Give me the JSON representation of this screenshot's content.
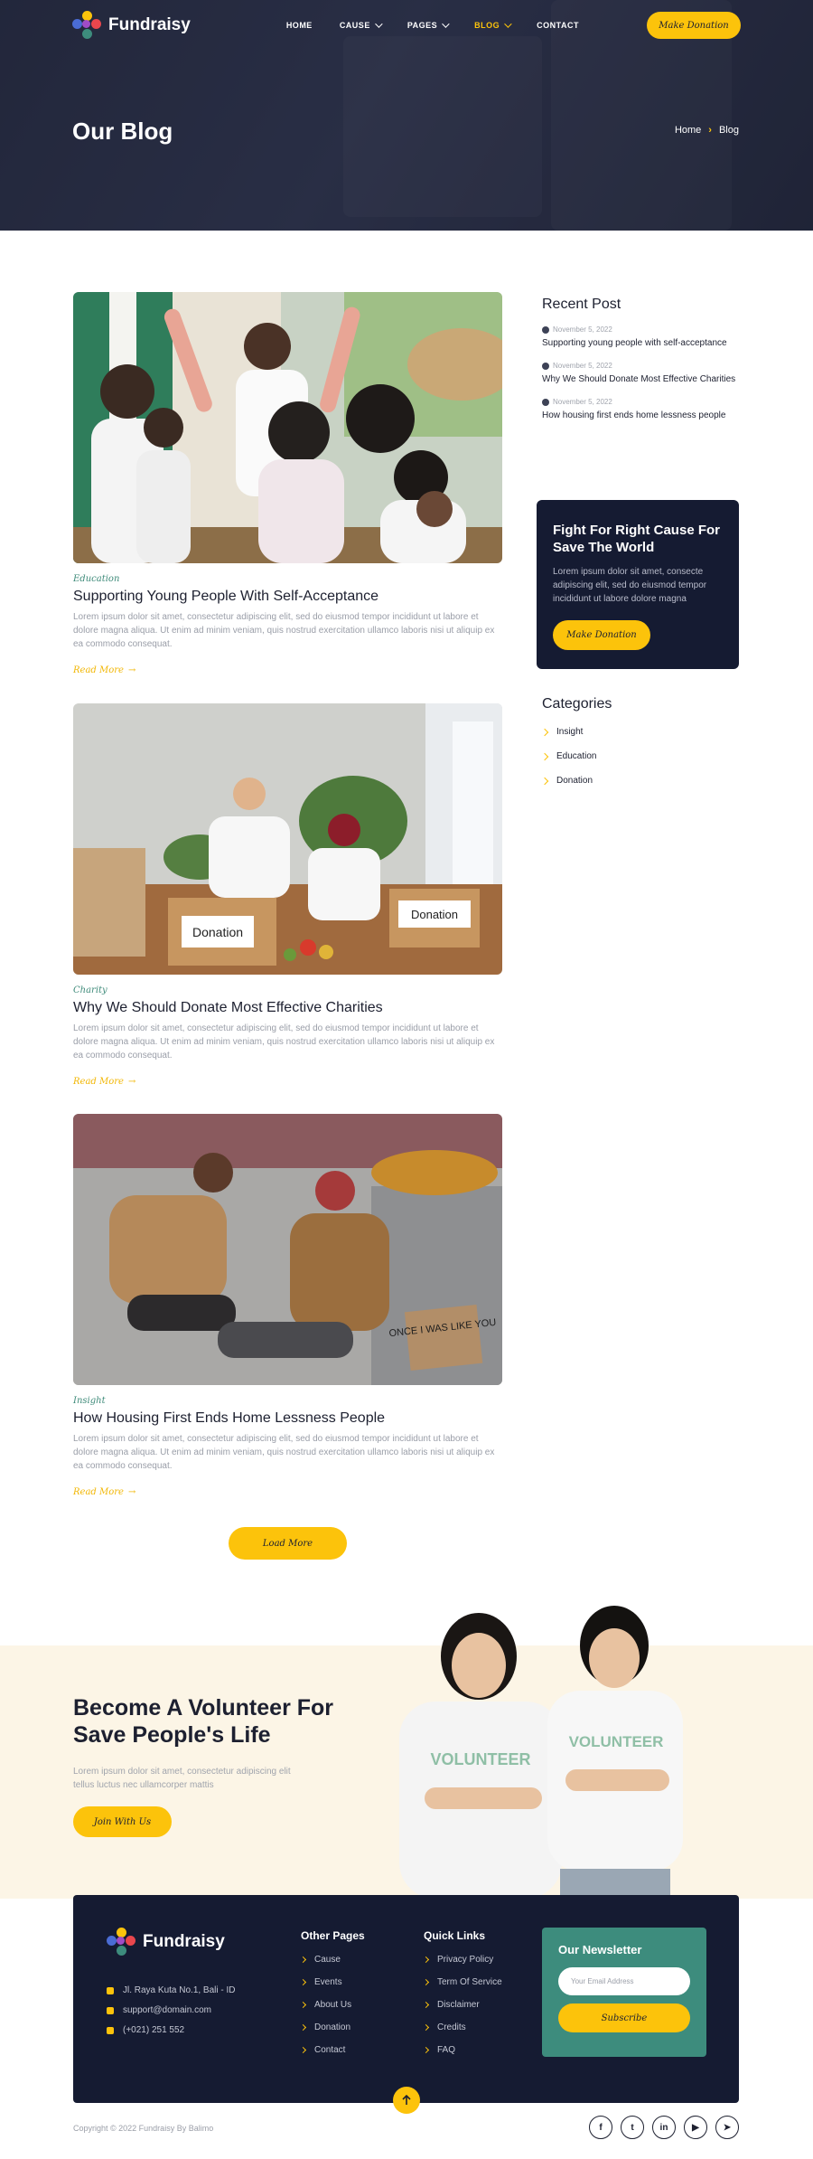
{
  "brand": {
    "name": "Fundraisy",
    "accent": "#fcc30b",
    "navy": "#151b32",
    "teal": "#3d8c7d"
  },
  "nav": {
    "items": [
      {
        "label": "HOME",
        "dropdown": false,
        "active": false
      },
      {
        "label": "CAUSE",
        "dropdown": true,
        "active": false
      },
      {
        "label": "PAGES",
        "dropdown": true,
        "active": false
      },
      {
        "label": "BLOG",
        "dropdown": true,
        "active": true
      },
      {
        "label": "CONTACT",
        "dropdown": false,
        "active": false
      }
    ],
    "cta": "Make Donation"
  },
  "hero": {
    "title": "Our Blog",
    "breadcrumb": {
      "home": "Home",
      "current": "Blog"
    }
  },
  "posts": [
    {
      "category": "Education",
      "title": "Supporting Young People With Self-Acceptance",
      "excerpt": "Lorem ipsum dolor sit amet, consectetur adipiscing elit, sed do eiusmod tempor incididunt ut labore et dolore magna aliqua. Ut enim ad minim veniam, quis nostrud exercitation ullamco laboris nisi ut aliquip ex ea commodo consequat.",
      "read_more": "Read More"
    },
    {
      "category": "Charity",
      "title": "Why We Should Donate Most Effective Charities",
      "excerpt": "Lorem ipsum dolor sit amet, consectetur adipiscing elit, sed do eiusmod tempor incididunt ut labore et dolore magna aliqua. Ut enim ad minim veniam, quis nostrud exercitation ullamco laboris nisi ut aliquip ex ea commodo consequat.",
      "read_more": "Read More",
      "box_labels": [
        "Donation",
        "Donation"
      ]
    },
    {
      "category": "Insight",
      "title": "How Housing First Ends Home Lessness People",
      "excerpt": "Lorem ipsum dolor sit amet, consectetur adipiscing elit, sed do eiusmod tempor incididunt ut labore et dolore magna aliqua. Ut enim ad minim veniam, quis nostrud exercitation ullamco laboris nisi ut aliquip ex ea commodo consequat.",
      "read_more": "Read More",
      "sign_text": "ONCE I WAS LIKE YOU"
    }
  ],
  "load_more": "Load More",
  "sidebar": {
    "recent_title": "Recent Post",
    "recent": [
      {
        "date": "November 5, 2022",
        "title": "Supporting young people with self-acceptance"
      },
      {
        "date": "November 5, 2022",
        "title": "Why We Should Donate Most Effective Charities"
      },
      {
        "date": "November 5, 2022",
        "title": "How housing first ends home lessness people"
      }
    ],
    "cause_box": {
      "title": "Fight For Right Cause For Save The World",
      "text": "Lorem ipsum dolor sit amet, consecte adipiscing elit, sed do eiusmod tempor incididunt ut labore dolore magna",
      "button": "Make Donation"
    },
    "categories_title": "Categories",
    "categories": [
      "Insight",
      "Education",
      "Donation"
    ]
  },
  "volunteer": {
    "title": "Become A Volunteer For Save People's Life",
    "text": "Lorem ipsum dolor sit amet, consectetur adipiscing elit tellus luctus nec ullamcorper mattis",
    "button": "Join With Us",
    "shirt_text": "VOLUNTEER"
  },
  "footer": {
    "address": "Jl. Raya Kuta No.1, Bali - ID",
    "email": "support@domain.com",
    "phone": "(+021) 251 552",
    "other_pages_title": "Other Pages",
    "other_pages": [
      "Cause",
      "Events",
      "About Us",
      "Donation",
      "Contact"
    ],
    "quick_links_title": "Quick Links",
    "quick_links": [
      "Privacy Policy",
      "Term Of Service",
      "Disclaimer",
      "Credits",
      "FAQ"
    ],
    "newsletter": {
      "title": "Our Newsletter",
      "placeholder": "Your Email Address",
      "button": "Subscribe"
    },
    "copyright": "Copyright © 2022 Fundraisy By Balimo",
    "socials": [
      {
        "icon": "facebook-icon",
        "glyph": "f"
      },
      {
        "icon": "twitter-icon",
        "glyph": "t"
      },
      {
        "icon": "linkedin-icon",
        "glyph": "in"
      },
      {
        "icon": "youtube-icon",
        "glyph": "▶"
      },
      {
        "icon": "telegram-icon",
        "glyph": "➤"
      }
    ]
  }
}
